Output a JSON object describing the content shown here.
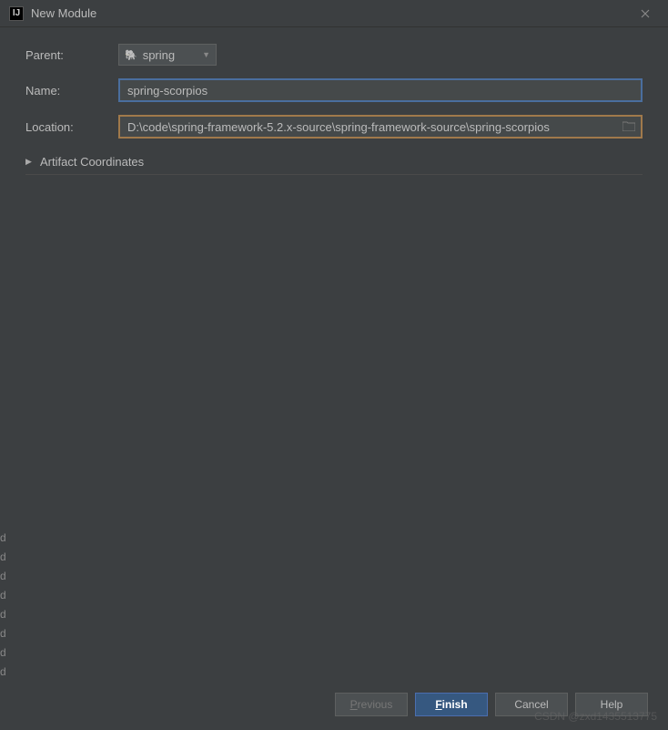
{
  "window": {
    "title": "New Module"
  },
  "form": {
    "parent_label": "Parent:",
    "parent_value": "spring",
    "name_label": "Name:",
    "name_value": "spring-scorpios",
    "location_label": "Location:",
    "location_value": "D:\\code\\spring-framework-5.2.x-source\\spring-framework-source\\spring-scorpios",
    "artifact_label": "Artifact Coordinates"
  },
  "buttons": {
    "previous": "Previous",
    "finish": "Finish",
    "cancel": "Cancel",
    "help": "Help"
  },
  "watermark": "CSDN @zxd1435513775"
}
